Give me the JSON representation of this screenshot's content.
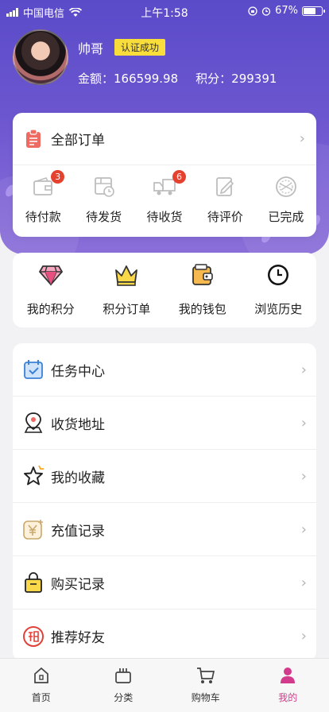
{
  "status_bar": {
    "carrier": "中国电信",
    "time": "上午1:58",
    "battery": "67%"
  },
  "profile": {
    "name": "帅哥",
    "verified_label": "认证成功",
    "balance_label": "金额：",
    "balance_value": "166599.98",
    "points_label": "积分：",
    "points_value": "299391"
  },
  "orders": {
    "title": "全部订单",
    "items": [
      {
        "label": "待付款",
        "badge": "3",
        "icon": "wallet-icon"
      },
      {
        "label": "待发货",
        "badge": "",
        "icon": "package-clock-icon"
      },
      {
        "label": "待收货",
        "badge": "6",
        "icon": "truck-icon"
      },
      {
        "label": "待评价",
        "badge": "",
        "icon": "edit-icon"
      },
      {
        "label": "已完成",
        "badge": "",
        "icon": "stamp-icon"
      }
    ]
  },
  "quick_links": [
    {
      "label": "我的积分",
      "icon": "diamond-icon"
    },
    {
      "label": "积分订单",
      "icon": "crown-icon"
    },
    {
      "label": "我的钱包",
      "icon": "wallet-icon"
    },
    {
      "label": "浏览历史",
      "icon": "clock-icon"
    }
  ],
  "menu": [
    {
      "label": "任务中心",
      "icon": "calendar-icon"
    },
    {
      "label": "收货地址",
      "icon": "location-icon"
    },
    {
      "label": "我的收藏",
      "icon": "star-icon"
    },
    {
      "label": "充值记录",
      "icon": "yuan-card-icon"
    },
    {
      "label": "购买记录",
      "icon": "bag-icon"
    },
    {
      "label": "推荐好友",
      "icon": "invite-icon"
    }
  ],
  "tabs": [
    {
      "label": "首页",
      "icon": "home-icon",
      "active": false
    },
    {
      "label": "分类",
      "icon": "category-icon",
      "active": false
    },
    {
      "label": "购物车",
      "icon": "cart-icon",
      "active": false
    },
    {
      "label": "我的",
      "icon": "user-icon",
      "active": true
    }
  ],
  "colors": {
    "header_purple": "#6c56cf",
    "badge_red": "#e5412f",
    "verify_yellow": "#f9de3b",
    "tab_active": "#d23a8c"
  }
}
